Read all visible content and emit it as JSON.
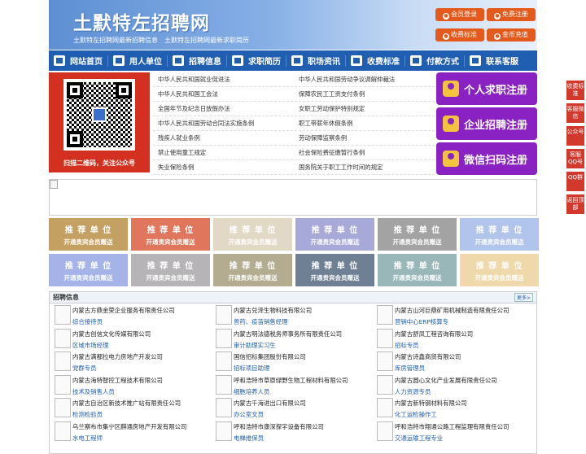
{
  "header": {
    "logo": "土默特左招聘网",
    "slogan": "土默特左招聘网最新招聘信息　土默特左招聘网最新求职简历",
    "buttons": [
      "会员登录",
      "免费注册",
      "收费标准",
      "金币充值"
    ]
  },
  "nav": [
    "网站首页",
    "用人单位",
    "招聘信息",
    "求职简历",
    "职场资讯",
    "收费标准",
    "付款方式",
    "联系客服"
  ],
  "qr": {
    "caption": "扫描二维码，关注公众号"
  },
  "laws": [
    [
      "中华人民共和国就业促进法",
      "中华人民共和国劳动争议调解仲裁法"
    ],
    [
      "中华人民共和国工会法",
      "保障农民工工资支付条例"
    ],
    [
      "全国年节及纪念日放假办法",
      "女职工劳动保护特别规定"
    ],
    [
      "中华人民共和国劳动合同法实施条例",
      "职工带薪年休假条例"
    ],
    [
      "残疾人就业条例",
      "劳动保障监察条例"
    ],
    [
      "禁止使用童工规定",
      "社会保险费征缴暂行条例"
    ],
    [
      "失业保险条例",
      "国务院关于职工工作时间的规定"
    ]
  ],
  "register": [
    "个人求职注册",
    "企业招聘注册",
    "微信扫码注册"
  ],
  "recommend": {
    "title": "推 荐 单 位",
    "subtitle": "开通贵宾会员赠送"
  },
  "rec_colors": [
    "#c4a163",
    "#e0765b",
    "#e2d8c6",
    "#a7a9d8",
    "#a3a3a3",
    "#b1c4eb",
    "#a5b3e8",
    "#b6b4b6",
    "#b3ac90",
    "#6f7f94",
    "#99b6b9",
    "#efd9aa"
  ],
  "jobs": {
    "title": "招聘信息",
    "more": "更多>",
    "rows": [
      [
        {
          "co": "内蒙古方鼎金荣企业服务有限责任公司",
          "pos": "综合接待员"
        },
        {
          "co": "内蒙古兑泽生物科技有限公司",
          "pos": "兽药、疫苗销售经理"
        },
        {
          "co": "内蒙古山河巨鼎矿用机械制造有限责任公司",
          "pos": "营销中心ERP核算专"
        }
      ],
      [
        {
          "co": "内蒙古创信文化传媒有限公司",
          "pos": "区域市场经理"
        },
        {
          "co": "内蒙古明法德税务师事务所有限责任公司",
          "pos": "审计助理实习生"
        },
        {
          "co": "内蒙古舒凤工程咨询有限公司",
          "pos": "招标专员"
        }
      ],
      [
        {
          "co": "内蒙古满都拉电力房地产开发公司",
          "pos": "党群专员"
        },
        {
          "co": "国信招标集团股份有限公司",
          "pos": "招标项目助理"
        },
        {
          "co": "内蒙古诗鑫商贸有限公司",
          "pos": "库房管理员"
        }
      ],
      [
        {
          "co": "内蒙古海特智控工程技术有限公司",
          "pos": "技术及销售人员"
        },
        {
          "co": "呼和浩特市草原绿野生物工程材料有限公司",
          "pos": "细胞培养人员"
        },
        {
          "co": "内蒙古圆心文化产业发展有限责任公司",
          "pos": "人力资源专员"
        }
      ],
      [
        {
          "co": "内蒙古自治区新技术推广站有限责任公司",
          "pos": "检测检验员"
        },
        {
          "co": "内蒙古千海进出口有限公司",
          "pos": "办公室文员"
        },
        {
          "co": "内蒙古新特钢材料有限公司",
          "pos": "化工运检操作工"
        }
      ],
      [
        {
          "co": "乌兰察布市集宁区麒通房地产开发有限公司",
          "pos": "水电工程师"
        },
        {
          "co": "呼和浩特市康深探宇设备有限公司",
          "pos": "电梯维保员"
        },
        {
          "co": "呼和浩特市翔通公路工程监理有限责任公司",
          "pos": "交通运输工程专业"
        }
      ]
    ]
  },
  "side": [
    "收费标准",
    "客服微信",
    "公众号",
    "客服QQ号",
    "QQ群",
    "返回顶部"
  ]
}
